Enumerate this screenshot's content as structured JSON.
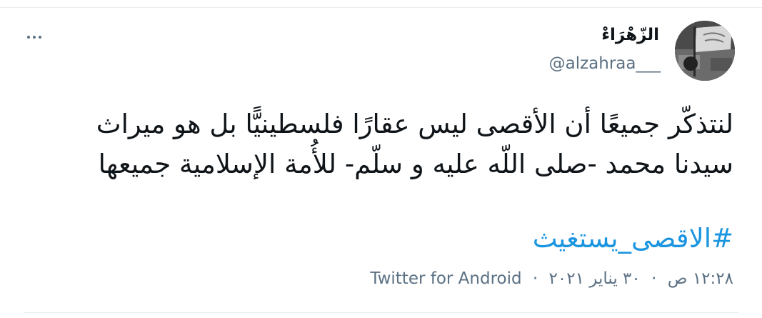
{
  "tweet": {
    "author": {
      "display_name": "الزّهْرَاءْ",
      "username": "@alzahraa___"
    },
    "text": "لنتذكّر جميعًا أن الأقصى ليس عقارًا فلسطينيًّا بل هو ميراث سيدنا محمد -صلى اللّه عليه و سلّم- للأُمة الإسلامية جميعها",
    "hashtag": "#الاقصى_يستغيث",
    "time": "١٢:٢٨ ص",
    "date": "٣٠ يناير ٢٠٢١",
    "separator": "·",
    "source": "Twitter for Android",
    "more_icon": "more-horizontal-icon"
  },
  "colors": {
    "text": "#0f1419",
    "secondary": "#5b7083",
    "link": "#1b95e0",
    "border": "#ebeef0"
  }
}
